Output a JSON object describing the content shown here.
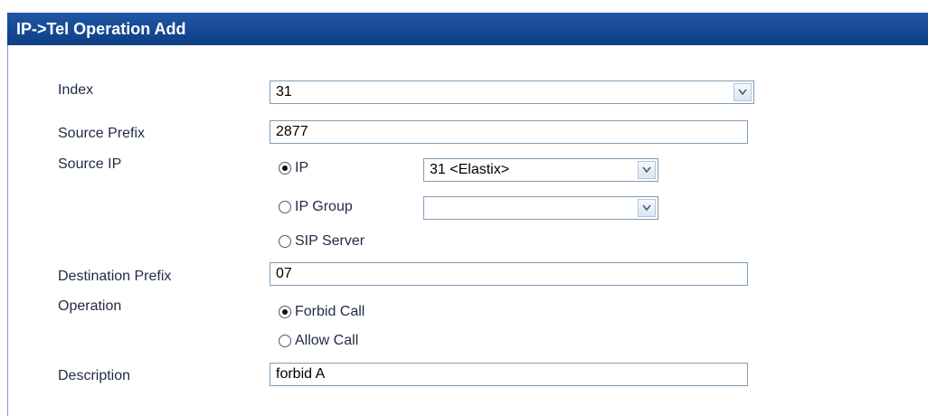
{
  "header": {
    "title": "IP->Tel Operation Add"
  },
  "form": {
    "index": {
      "label": "Index",
      "value": "31"
    },
    "source_prefix": {
      "label": "Source Prefix",
      "value": "2877"
    },
    "source_ip": {
      "label": "Source IP",
      "options": [
        {
          "label": "IP",
          "checked": true
        },
        {
          "label": "IP Group",
          "checked": false
        },
        {
          "label": "SIP Server",
          "checked": false
        }
      ],
      "ip_select": "31 <Elastix>",
      "ip_group_select": ""
    },
    "destination_prefix": {
      "label": "Destination Prefix",
      "value": "07"
    },
    "operation": {
      "label": "Operation",
      "options": [
        {
          "label": "Forbid Call",
          "checked": true
        },
        {
          "label": "Allow Call",
          "checked": false
        }
      ]
    },
    "description": {
      "label": "Description",
      "value": "forbid A"
    }
  }
}
